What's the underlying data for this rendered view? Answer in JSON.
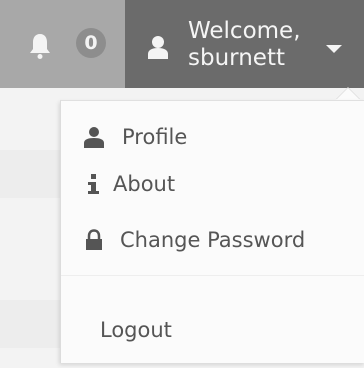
{
  "header": {
    "notification_count": "0",
    "welcome_line1": "Welcome,",
    "welcome_line2": "sburnett"
  },
  "dropdown": {
    "items": [
      {
        "label": "Profile",
        "icon": "user-icon"
      },
      {
        "label": "About",
        "icon": "info-icon"
      },
      {
        "label": "Change Password",
        "icon": "lock-icon"
      },
      {
        "label": "Logout"
      }
    ]
  },
  "colors": {
    "notif_bg": "#a8a8a8",
    "user_bg": "#6b6b6b",
    "dropdown_bg": "#fbfbfb",
    "menu_text": "#555555"
  }
}
